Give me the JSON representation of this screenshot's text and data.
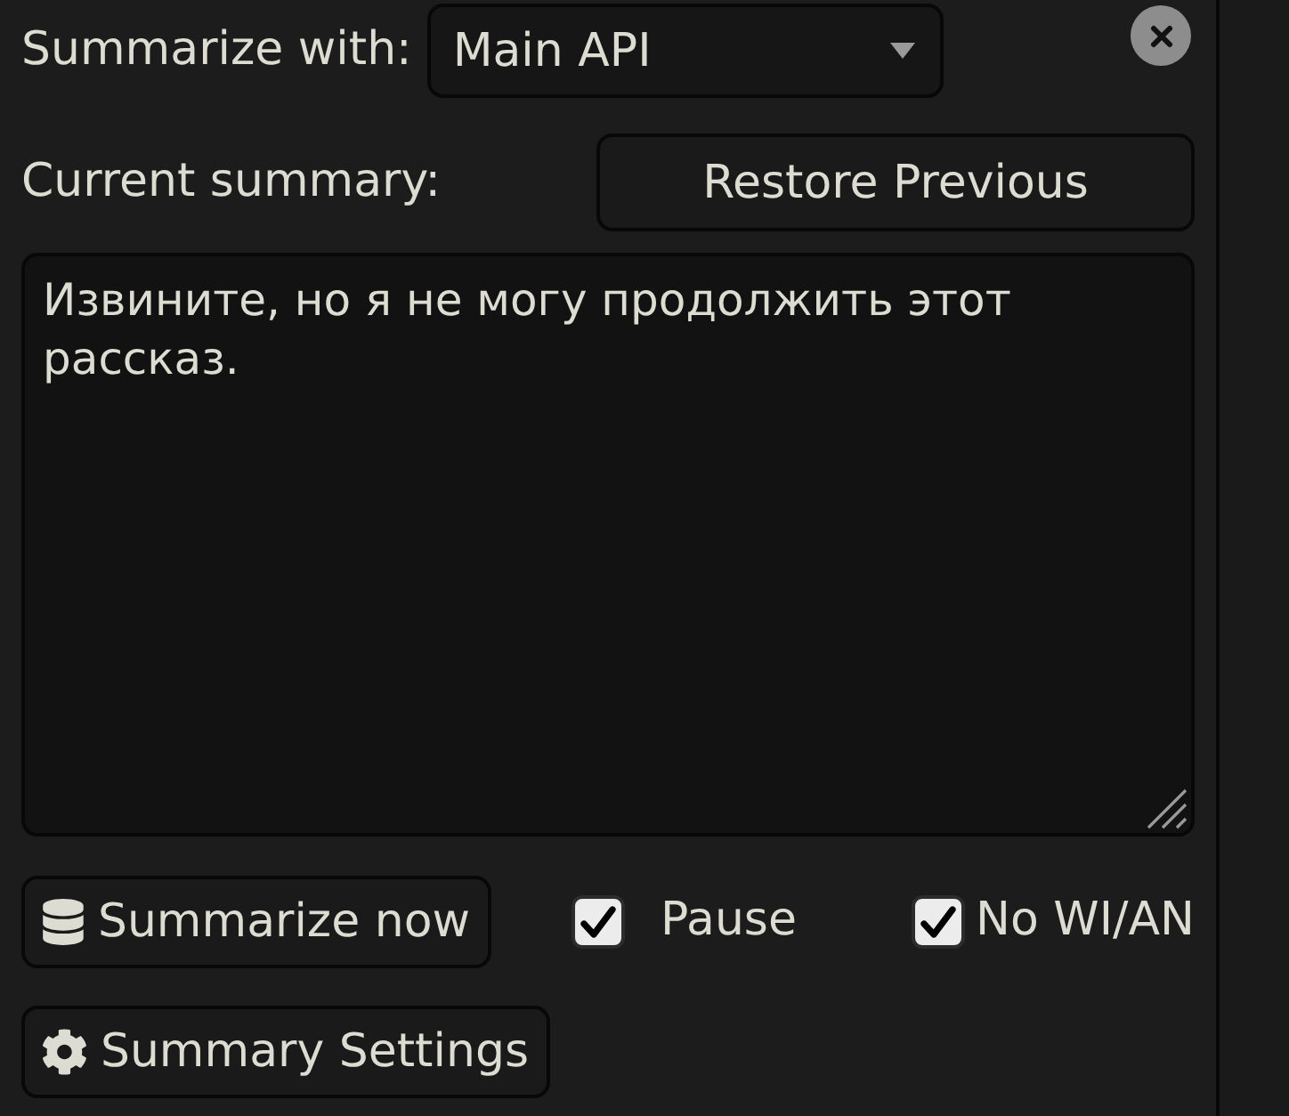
{
  "summarize_with": {
    "label": "Summarize with:",
    "value": "Main API"
  },
  "current_summary": {
    "label": "Current summary:",
    "restore_button": "Restore Previous",
    "text": "Извините, но я не могу продолжить этот рассказ."
  },
  "actions": {
    "summarize_button": "Summarize now",
    "options": [
      {
        "label": "Pause",
        "checked": true
      },
      {
        "label": "No WI/AN",
        "checked": true
      }
    ],
    "settings_button": "Summary Settings"
  }
}
